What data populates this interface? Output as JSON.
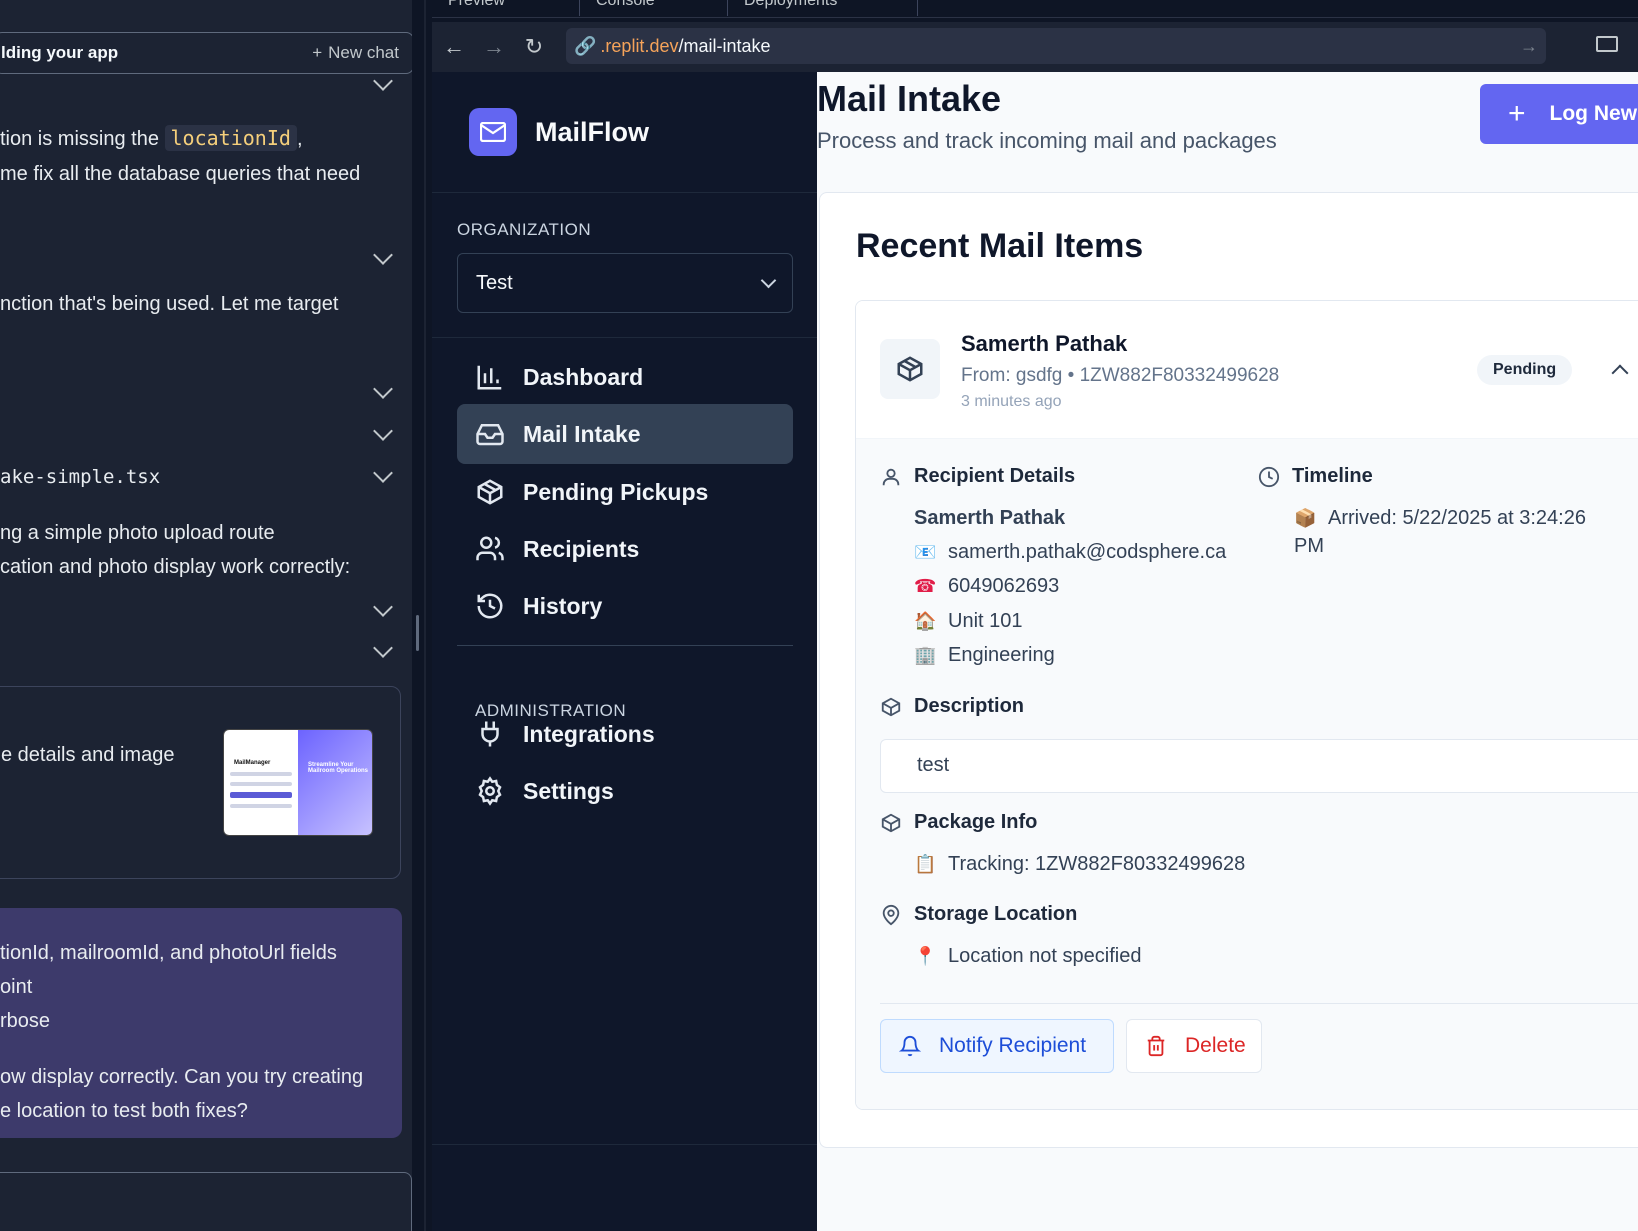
{
  "chat": {
    "header_title": "lding your app",
    "new_chat_label": "New chat",
    "lines": [
      {
        "pre": "tion is missing the ",
        "code": "locationId",
        "post": ","
      },
      {
        "text": "me fix all the database queries that need"
      },
      {
        "text": "nction that's being used. Let me target"
      },
      {
        "text": "ake-simple.tsx"
      },
      {
        "text": "ng a simple photo upload route"
      },
      {
        "text": "cation and photo display work correctly:"
      },
      {
        "text": "e details and image"
      },
      {
        "text": "tionId, mailroomId, and photoUrl fields"
      },
      {
        "text": "oint"
      },
      {
        "text": "rbose"
      },
      {
        "text": "ow display correctly. Can you try creating"
      },
      {
        "text": "e location to test both fixes?"
      }
    ],
    "thumb_title": "MailManager",
    "thumb_tagline": "Streamline Your Mailroom Operations"
  },
  "browser": {
    "tabs": [
      "Preview",
      "Console",
      "Deployments"
    ],
    "url_domain": ".replit.dev",
    "url_path": "/mail-intake"
  },
  "sidebar": {
    "brand": "MailFlow",
    "org_label": "ORGANIZATION",
    "org_value": "Test",
    "nav": [
      {
        "label": "Dashboard",
        "icon": "bar-chart-icon"
      },
      {
        "label": "Mail Intake",
        "icon": "inbox-icon",
        "active": true
      },
      {
        "label": "Pending Pickups",
        "icon": "package-icon"
      },
      {
        "label": "Recipients",
        "icon": "users-icon"
      },
      {
        "label": "History",
        "icon": "history-icon"
      }
    ],
    "admin_label": "ADMINISTRATION",
    "admin_nav": [
      {
        "label": "Integrations",
        "icon": "plug-icon"
      },
      {
        "label": "Settings",
        "icon": "gear-icon"
      }
    ]
  },
  "main": {
    "title": "Mail Intake",
    "subtitle": "Process and track incoming mail and packages",
    "log_button": "Log New",
    "card_title": "Recent Mail Items",
    "item": {
      "recipient": "Samerth Pathak",
      "from_line": "From: gsdfg • 1ZW882F80332499628",
      "time_ago": "3 minutes ago",
      "status": "Pending",
      "recipient_details_label": "Recipient Details",
      "recipient_name": "Samerth Pathak",
      "email": "samerth.pathak@codsphere.ca",
      "phone": "6049062693",
      "unit": "Unit 101",
      "department": "Engineering",
      "timeline_label": "Timeline",
      "arrived": "Arrived: 5/22/2025 at 3:24:26",
      "arrived_cont": "PM",
      "description_label": "Description",
      "description": "test",
      "package_label": "Package Info",
      "tracking": "Tracking: 1ZW882F80332499628",
      "storage_label": "Storage Location",
      "storage": "Location not specified",
      "notify_button": "Notify Recipient",
      "delete_button": "Delete"
    }
  }
}
